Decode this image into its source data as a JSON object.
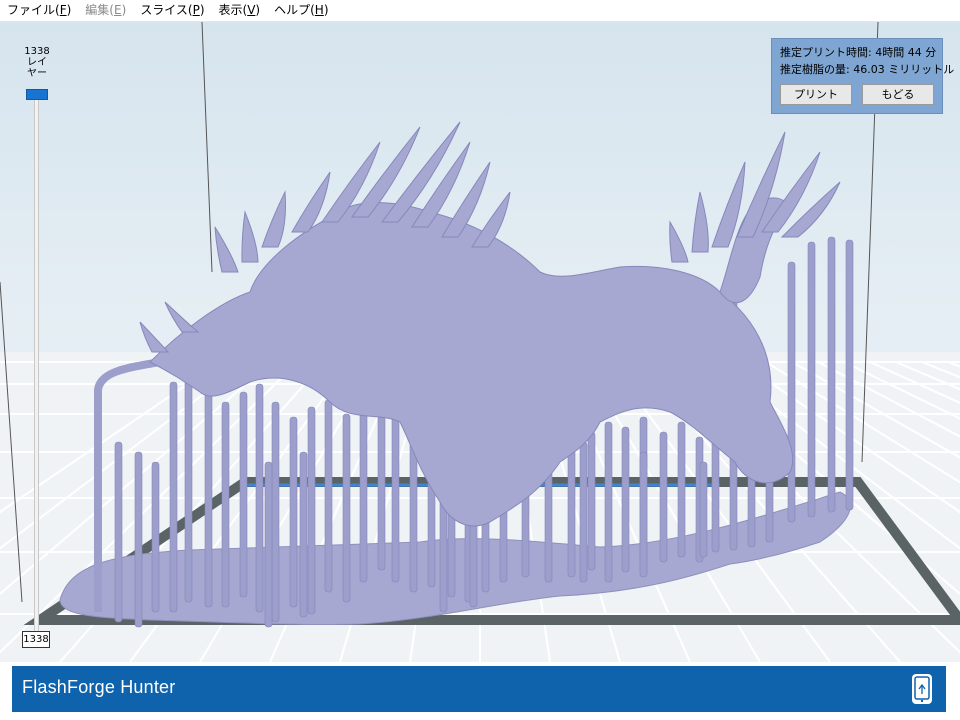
{
  "menu": [
    {
      "label": "ファイル(",
      "key": "F",
      "suffix": ")",
      "disabled": false
    },
    {
      "label": "編集(",
      "key": "E",
      "suffix": ")",
      "disabled": true
    },
    {
      "label": "スライス(",
      "key": "P",
      "suffix": ")",
      "disabled": false
    },
    {
      "label": "表示(",
      "key": "V",
      "suffix": ")",
      "disabled": false
    },
    {
      "label": "ヘルプ(",
      "key": "H",
      "suffix": ")",
      "disabled": false
    }
  ],
  "layer": {
    "current": "1338",
    "unit_line1": "レイ",
    "unit_line2": "ヤー",
    "bottom": "1338"
  },
  "info": {
    "print_time_label": "推定プリント時間:",
    "print_time_value": "4時間 44 分",
    "resin_label": "推定樹脂の量:",
    "resin_value": "46.03 ミリリットル",
    "print_button": "プリント",
    "back_button": "もどる"
  },
  "footer": {
    "title": "FlashForge Hunter",
    "icon": "phone-link-icon"
  },
  "colors": {
    "accent": "#0f63ad",
    "model": "#a6a8d2",
    "panel": "#7fa6d3"
  }
}
